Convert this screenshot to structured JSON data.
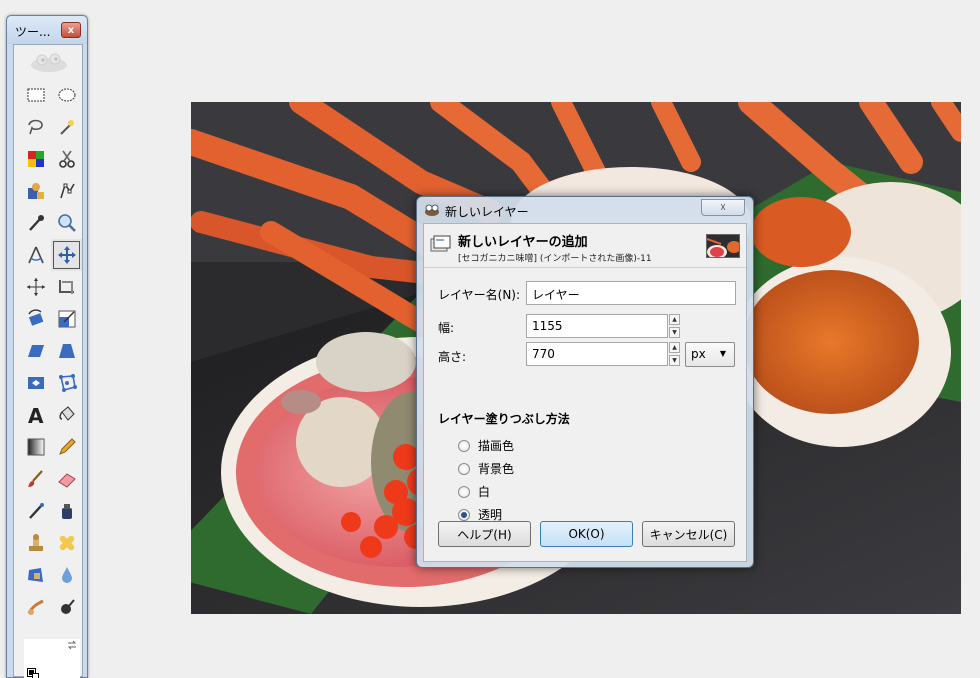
{
  "toolbox": {
    "title": "ツー...",
    "close_label": "x",
    "tools": [
      "rect-select-icon",
      "ellipse-select-icon",
      "free-select-icon",
      "fuzzy-select-icon",
      "color-select-icon",
      "scissors-select-icon",
      "foreground-select-icon",
      "paths-icon",
      "color-picker-icon",
      "zoom-icon",
      "measure-icon",
      "move-icon",
      "align-icon",
      "crop-icon",
      "rotate-icon",
      "scale-icon",
      "shear-icon",
      "perspective-icon",
      "flip-icon",
      "cage-transform-icon",
      "text-icon",
      "bucket-fill-icon",
      "blend-icon",
      "pencil-icon",
      "paintbrush-icon",
      "eraser-icon",
      "airbrush-icon",
      "ink-icon",
      "clone-icon",
      "heal-icon",
      "perspective-clone-icon",
      "blur-icon",
      "smudge-icon",
      "dodge-burn-icon"
    ],
    "active_tool": "move-icon",
    "fg_color": "#000000",
    "bg_color": "#ffffff"
  },
  "dialog": {
    "title": "新しいレイヤー",
    "close_label": "☓",
    "header_title": "新しいレイヤーの追加",
    "header_subtitle": "[セコガニカニ味噌] (インポートされた画像)-11",
    "layer_name_label": "レイヤー名(N):",
    "layer_name_value": "レイヤー",
    "width_label": "幅:",
    "width_value": "1155",
    "height_label": "高さ:",
    "height_value": "770",
    "unit": "px",
    "fill_section_title": "レイヤー塗りつぶし方法",
    "fill_options": [
      "描画色",
      "背景色",
      "白",
      "透明"
    ],
    "fill_selected": "透明",
    "help_button": "ヘルプ(H)",
    "ok_button": "OK(O)",
    "cancel_button": "キャンセル(C)"
  }
}
